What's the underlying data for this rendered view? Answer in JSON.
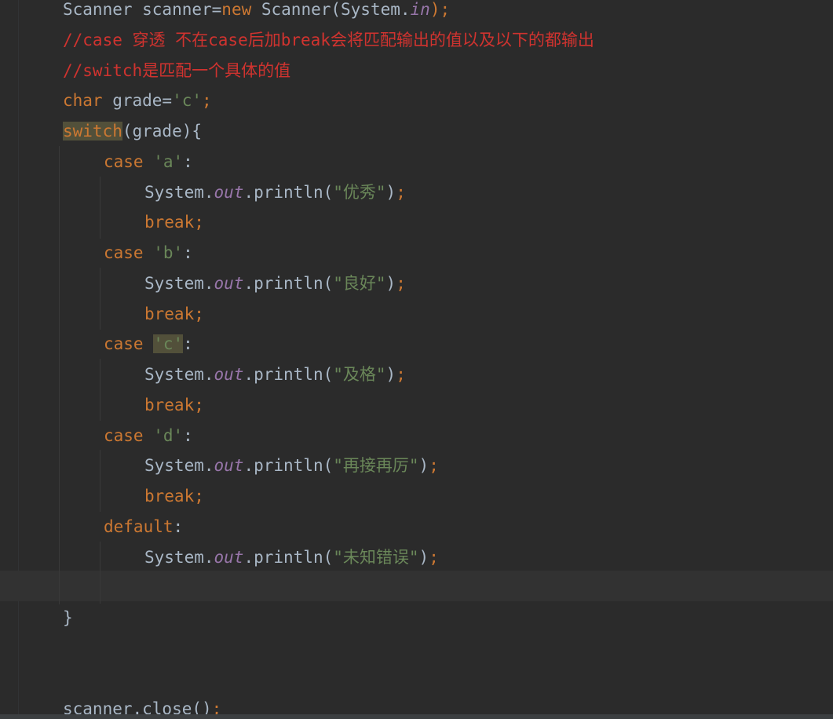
{
  "editor": {
    "lines": [
      {
        "id": "line-scanner-decl",
        "indent": 0,
        "tokens": [
          {
            "t": "Scanner scanner=",
            "c": "plain"
          },
          {
            "t": "new",
            "c": "kw"
          },
          {
            "t": " Scanner(System.",
            "c": "plain"
          },
          {
            "t": "in",
            "c": "fld"
          },
          {
            "t": ");",
            "c": "kw"
          }
        ]
      },
      {
        "id": "line-comment-1",
        "indent": 0,
        "tokens": [
          {
            "t": "//case 穿透 不在case后加break会将匹配输出的值以及以下的都输出",
            "c": "cm"
          }
        ]
      },
      {
        "id": "line-comment-2",
        "indent": 0,
        "tokens": [
          {
            "t": "//switch是匹配一个具体的值",
            "c": "cm"
          }
        ]
      },
      {
        "id": "line-char-decl",
        "indent": 0,
        "tokens": [
          {
            "t": "char",
            "c": "kw"
          },
          {
            "t": " grade=",
            "c": "plain"
          },
          {
            "t": "'c'",
            "c": "str"
          },
          {
            "t": ";",
            "c": "kw"
          }
        ]
      },
      {
        "id": "line-switch",
        "indent": 0,
        "tokens": [
          {
            "t": "switch",
            "c": "kw",
            "hl": true
          },
          {
            "t": "(grade){",
            "c": "plain"
          }
        ]
      },
      {
        "id": "line-case-a",
        "indent": 1,
        "tokens": [
          {
            "t": "case ",
            "c": "kw"
          },
          {
            "t": "'a'",
            "c": "str"
          },
          {
            "t": ":",
            "c": "plain"
          }
        ]
      },
      {
        "id": "line-println-a",
        "indent": 2,
        "tokens": [
          {
            "t": "System.",
            "c": "plain"
          },
          {
            "t": "out",
            "c": "fld"
          },
          {
            "t": ".println(",
            "c": "plain"
          },
          {
            "t": "\"优秀\"",
            "c": "str"
          },
          {
            "t": ")",
            "c": "plain"
          },
          {
            "t": ";",
            "c": "kw"
          }
        ]
      },
      {
        "id": "line-break-a",
        "indent": 2,
        "tokens": [
          {
            "t": "break;",
            "c": "kw"
          }
        ]
      },
      {
        "id": "line-case-b",
        "indent": 1,
        "tokens": [
          {
            "t": "case ",
            "c": "kw"
          },
          {
            "t": "'b'",
            "c": "str"
          },
          {
            "t": ":",
            "c": "plain"
          }
        ]
      },
      {
        "id": "line-println-b",
        "indent": 2,
        "tokens": [
          {
            "t": "System.",
            "c": "plain"
          },
          {
            "t": "out",
            "c": "fld"
          },
          {
            "t": ".println(",
            "c": "plain"
          },
          {
            "t": "\"良好\"",
            "c": "str"
          },
          {
            "t": ")",
            "c": "plain"
          },
          {
            "t": ";",
            "c": "kw"
          }
        ]
      },
      {
        "id": "line-break-b",
        "indent": 2,
        "tokens": [
          {
            "t": "break;",
            "c": "kw"
          }
        ]
      },
      {
        "id": "line-case-c",
        "indent": 1,
        "tokens": [
          {
            "t": "case ",
            "c": "kw"
          },
          {
            "t": "'c'",
            "c": "str",
            "hl": true
          },
          {
            "t": ":",
            "c": "plain"
          }
        ]
      },
      {
        "id": "line-println-c",
        "indent": 2,
        "tokens": [
          {
            "t": "System.",
            "c": "plain"
          },
          {
            "t": "out",
            "c": "fld"
          },
          {
            "t": ".println(",
            "c": "plain"
          },
          {
            "t": "\"及格\"",
            "c": "str"
          },
          {
            "t": ")",
            "c": "plain"
          },
          {
            "t": ";",
            "c": "kw"
          }
        ]
      },
      {
        "id": "line-break-c",
        "indent": 2,
        "tokens": [
          {
            "t": "break;",
            "c": "kw"
          }
        ]
      },
      {
        "id": "line-case-d",
        "indent": 1,
        "tokens": [
          {
            "t": "case ",
            "c": "kw"
          },
          {
            "t": "'d'",
            "c": "str"
          },
          {
            "t": ":",
            "c": "plain"
          }
        ]
      },
      {
        "id": "line-println-d",
        "indent": 2,
        "tokens": [
          {
            "t": "System.",
            "c": "plain"
          },
          {
            "t": "out",
            "c": "fld"
          },
          {
            "t": ".println(",
            "c": "plain"
          },
          {
            "t": "\"再接再厉\"",
            "c": "str"
          },
          {
            "t": ")",
            "c": "plain"
          },
          {
            "t": ";",
            "c": "kw"
          }
        ]
      },
      {
        "id": "line-break-d",
        "indent": 2,
        "tokens": [
          {
            "t": "break;",
            "c": "kw"
          }
        ]
      },
      {
        "id": "line-default",
        "indent": 1,
        "tokens": [
          {
            "t": "default",
            "c": "kw"
          },
          {
            "t": ":",
            "c": "plain"
          }
        ]
      },
      {
        "id": "line-println-default",
        "indent": 2,
        "tokens": [
          {
            "t": "System.",
            "c": "plain"
          },
          {
            "t": "out",
            "c": "fld"
          },
          {
            "t": ".println(",
            "c": "plain"
          },
          {
            "t": "\"未知错误\"",
            "c": "str"
          },
          {
            "t": ")",
            "c": "plain"
          },
          {
            "t": ";",
            "c": "kw"
          }
        ]
      },
      {
        "id": "line-empty-caret",
        "indent": 2,
        "tokens": []
      },
      {
        "id": "line-close-brace",
        "indent": 0,
        "tokens": [
          {
            "t": "}",
            "c": "plain"
          }
        ]
      },
      {
        "id": "line-empty-1",
        "indent": 0,
        "tokens": []
      },
      {
        "id": "line-empty-2",
        "indent": 0,
        "tokens": []
      },
      {
        "id": "line-scanner-close",
        "indent": 0,
        "tokens": [
          {
            "t": "scanner.close()",
            "c": "plain"
          },
          {
            "t": ";",
            "c": "kw"
          }
        ]
      }
    ]
  }
}
